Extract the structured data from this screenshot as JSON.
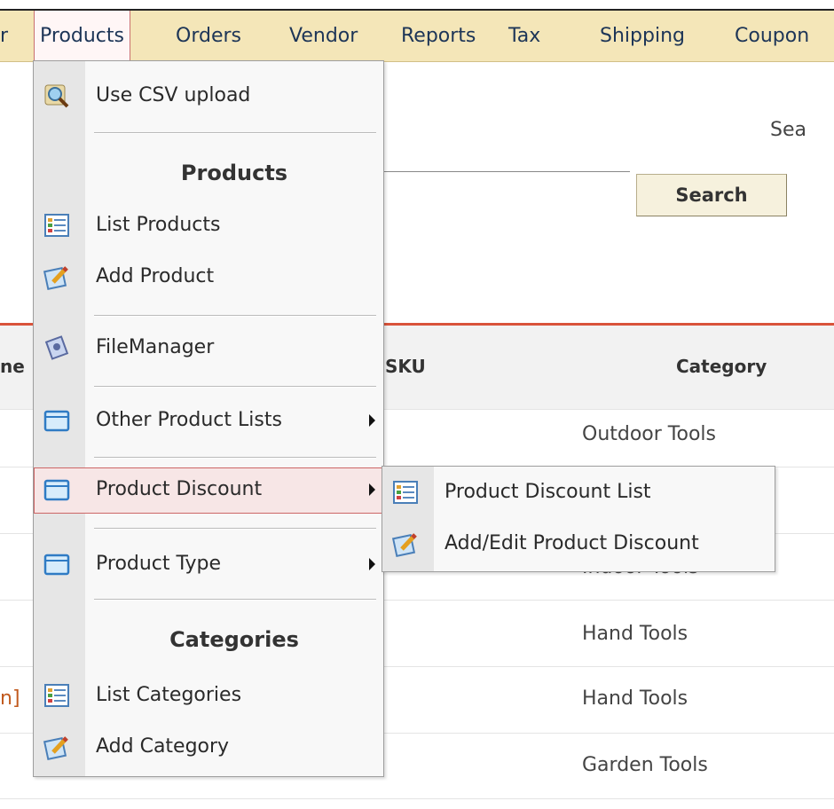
{
  "topbar": {
    "items": [
      "r",
      "Products",
      "Orders",
      "Vendor",
      "Reports",
      "Tax",
      "Shipping",
      "Coupon"
    ]
  },
  "page": {
    "search_label": "Sea",
    "search_button": "Search",
    "columns": [
      "ne",
      "SKU",
      "Category"
    ],
    "categories": [
      "Outdoor Tools",
      "Indoor Tools",
      "Hand Tools",
      "Hand Tools",
      "Garden Tools"
    ],
    "row_fragment": "n]"
  },
  "menu": {
    "csv_upload": "Use CSV upload",
    "products_header": "Products",
    "list_products": "List Products",
    "add_product": "Add Product",
    "file_manager": "FileManager",
    "other_lists": "Other Product Lists",
    "product_discount": "Product Discount",
    "product_type": "Product Type",
    "categories_header": "Categories",
    "list_categories": "List Categories",
    "add_category": "Add Category"
  },
  "submenu": {
    "discount_list": "Product Discount List",
    "add_edit_discount": "Add/Edit Product Discount"
  },
  "colors": {
    "menubar": "#f4e6b8",
    "menu_text": "#1d3557",
    "table_rule": "#d9533a",
    "hover_outline": "#cc6666"
  }
}
